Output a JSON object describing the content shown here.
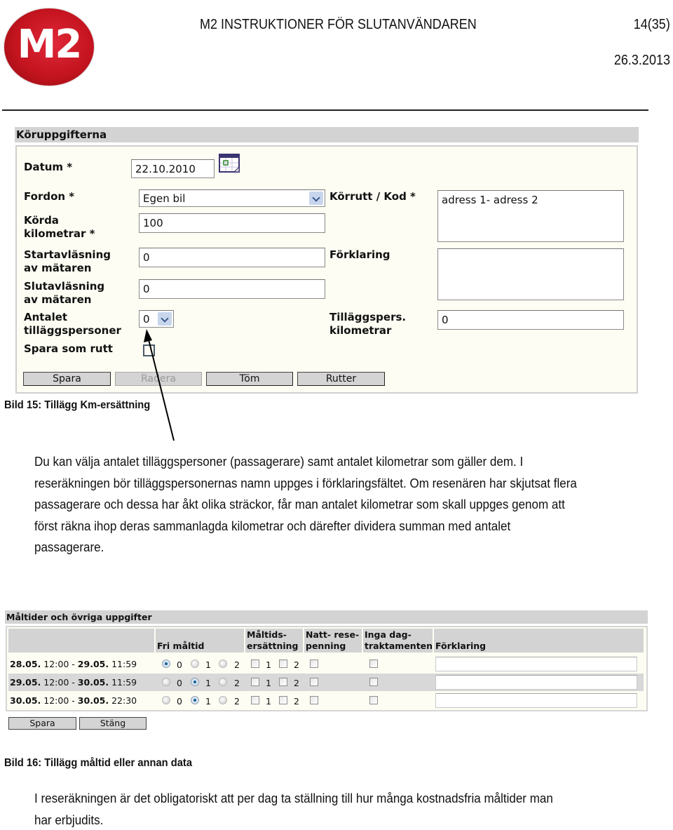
{
  "header": {
    "logo_text": "M2",
    "title": "M2 INSTRUKTIONER FÖR SLUTANVÄNDAREN",
    "page": "14(35)",
    "date": "26.3.2013"
  },
  "form1": {
    "title": "Köruppgifterna",
    "fields": {
      "datum": {
        "label": "Datum *",
        "value": "22.10.2010"
      },
      "fordon": {
        "label": "Fordon *",
        "value": "Egen bil"
      },
      "korda_km": {
        "label_line1": "Körda",
        "label_line2": "kilometrar *",
        "value": "100"
      },
      "start": {
        "label_line1": "Startavläsning",
        "label_line2": "av mätaren",
        "value": "0"
      },
      "slut": {
        "label_line1": "Slutavläsning",
        "label_line2": "av mätaren",
        "value": "0"
      },
      "antalet": {
        "label_line1": "Antalet",
        "label_line2": "tilläggspersoner",
        "value": "0"
      },
      "spara_rutt": {
        "label": "Spara som rutt",
        "checked": false
      },
      "korrutt": {
        "label": "Körrutt / Kod *",
        "value": "adress 1- adress 2"
      },
      "forklaring": {
        "label": "Förklaring",
        "value": ""
      },
      "tillaggspers_km": {
        "label_line1": "Tilläggspers.",
        "label_line2": "kilometrar",
        "value": "0"
      }
    },
    "buttons": {
      "spara": "Spara",
      "radera": "Radera",
      "tom": "Töm",
      "rutter": "Rutter"
    }
  },
  "caption1": "Bild 15: Tillägg Km-ersättning",
  "paragraph1": [
    "Du kan välja antalet tilläggspersoner (passagerare) samt antalet kilometrar som gäller dem. I",
    "reseräkningen bör tilläggspersonernas namn uppges i förklaringsfältet. Om resenären har skjutsat flera",
    "passagerare och dessa har åkt olika sträckor, får man antalet kilometrar som skall uppges genom att",
    "först räkna ihop deras sammanlagda kilometrar och därefter dividera summan med antalet",
    "passagerare."
  ],
  "form2": {
    "title": "Måltider och övriga uppgifter",
    "headers": {
      "fri_maltid": "Fri måltid",
      "maltids_l1": "Måltids-",
      "maltids_l2": "ersättning",
      "natt_l1": "Natt- rese-",
      "natt_l2": "penning",
      "inga_l1": "Inga dag-",
      "inga_l2": "traktamenten",
      "forklaring": "Förklaring"
    },
    "option_labels": {
      "r0": "0",
      "r1": "1",
      "r2": "2",
      "c1": "1",
      "c2": "2"
    },
    "rows": [
      {
        "d1": "28.05.",
        "t1": "12:00",
        "sep": "-",
        "d2": "29.05.",
        "t2": "11:59",
        "fri_maltid": 0,
        "maltid_1": false,
        "maltid_2": false,
        "natt": false,
        "inga": false,
        "forklaring": ""
      },
      {
        "d1": "29.05.",
        "t1": "12:00",
        "sep": "-",
        "d2": "30.05.",
        "t2": "11:59",
        "fri_maltid": 1,
        "maltid_1": false,
        "maltid_2": false,
        "natt": false,
        "inga": false,
        "forklaring": ""
      },
      {
        "d1": "30.05.",
        "t1": "12:00",
        "sep": "-",
        "d2": "30.05.",
        "t2": "22:30",
        "fri_maltid": 1,
        "maltid_1": false,
        "maltid_2": false,
        "natt": false,
        "inga": false,
        "forklaring": ""
      }
    ],
    "buttons": {
      "spara": "Spara",
      "stang": "Stäng"
    }
  },
  "caption2": "Bild 16: Tillägg måltid eller annan data",
  "paragraph2": [
    "I reseräkningen är det obligatoriskt att per dag ta ställning till hur många kostnadsfria måltider man",
    "har erbjudits."
  ],
  "colors": {
    "logo_red": "#c4141f",
    "panel_bg": "#fdfdf3",
    "title_bar": "#d3d3d3",
    "radio_selected": "#2c74ad"
  }
}
